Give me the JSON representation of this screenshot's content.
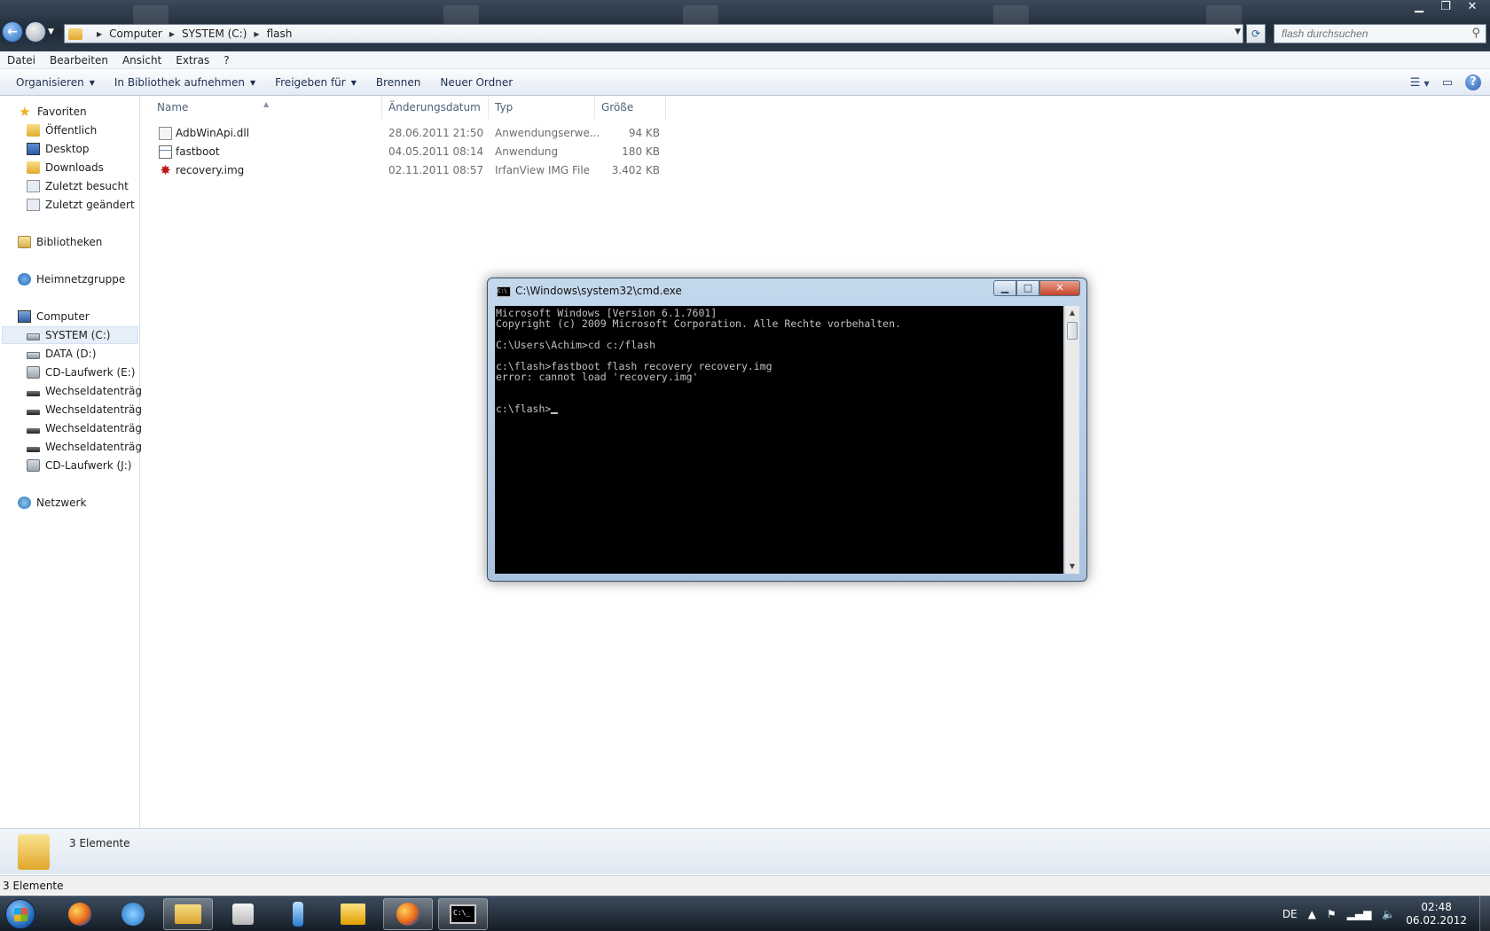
{
  "window": {
    "controls": {
      "minimize": "▁",
      "maximize": "❐",
      "close": "✕"
    }
  },
  "address": {
    "crumbs": [
      "Computer",
      "SYSTEM (C:)",
      "flash"
    ],
    "search_placeholder": "flash durchsuchen"
  },
  "menubar": [
    "Datei",
    "Bearbeiten",
    "Ansicht",
    "Extras",
    "?"
  ],
  "commandbar": {
    "organize": "Organisieren",
    "include_library": "In Bibliothek aufnehmen",
    "share": "Freigeben für",
    "burn": "Brennen",
    "new_folder": "Neuer Ordner"
  },
  "navpane": {
    "favorites": "Favoriten",
    "favorite_items": [
      "Öffentlich",
      "Desktop",
      "Downloads",
      "Zuletzt besucht",
      "Zuletzt geändert"
    ],
    "libraries": "Bibliotheken",
    "homegroup": "Heimnetzgruppe",
    "computer": "Computer",
    "drives": [
      "SYSTEM (C:)",
      "DATA (D:)",
      "CD-Laufwerk (E:)",
      "Wechseldatenträger",
      "Wechseldatenträger",
      "Wechseldatenträger",
      "Wechseldatenträger",
      "CD-Laufwerk (J:)"
    ],
    "network": "Netzwerk"
  },
  "filelist": {
    "columns": {
      "name": "Name",
      "date": "Änderungsdatum",
      "type": "Typ",
      "size": "Größe"
    },
    "rows": [
      {
        "name": "AdbWinApi.dll",
        "date": "28.06.2011 21:50",
        "type": "Anwendungserwe...",
        "size": "94 KB"
      },
      {
        "name": "fastboot",
        "date": "04.05.2011 08:14",
        "type": "Anwendung",
        "size": "180 KB"
      },
      {
        "name": "recovery.img",
        "date": "02.11.2011 08:57",
        "type": "IrfanView IMG File",
        "size": "3.402 KB"
      }
    ]
  },
  "details": {
    "count": "3 Elemente"
  },
  "statusbar": {
    "count": "3 Elemente"
  },
  "cmd": {
    "title": "C:\\Windows\\system32\\cmd.exe",
    "lines": [
      "Microsoft Windows [Version 6.1.7601]",
      "Copyright (c) 2009 Microsoft Corporation. Alle Rechte vorbehalten.",
      "",
      "C:\\Users\\Achim>cd c:/flash",
      "",
      "c:\\flash>fastboot flash recovery recovery.img",
      "error: cannot load 'recovery.img'",
      "",
      ""
    ],
    "prompt": "c:\\flash>",
    "icon_label": "C:\\_"
  },
  "tray": {
    "language": "DE",
    "time": "02:48",
    "date": "06.02.2012"
  }
}
